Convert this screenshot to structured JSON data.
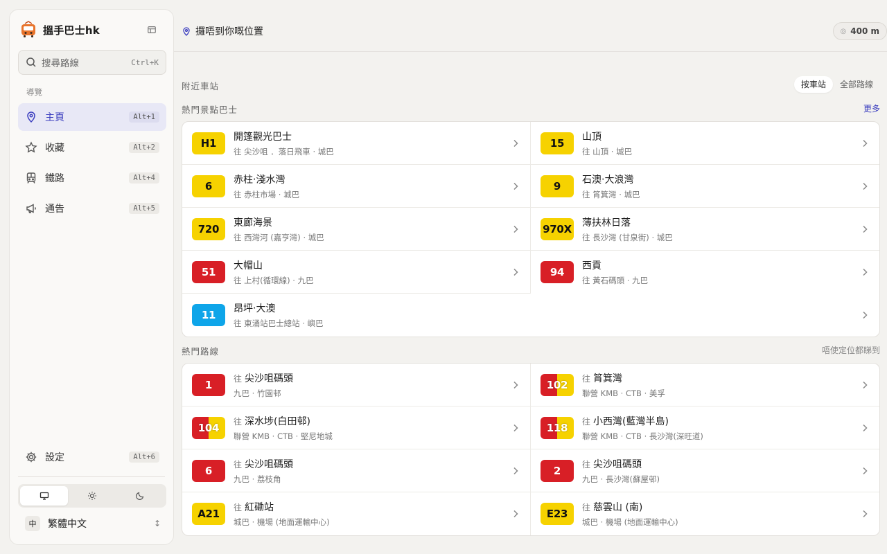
{
  "app": {
    "name": "搵手巴士",
    "name_suffix": "hk"
  },
  "search": {
    "placeholder": "搜尋路線",
    "shortcut": "Ctrl+K"
  },
  "nav": {
    "section_label": "導覽",
    "items": [
      {
        "label": "主頁",
        "shortcut": "Alt+1",
        "icon": "map-pin-icon"
      },
      {
        "label": "收藏",
        "shortcut": "Alt+2",
        "icon": "star-icon"
      },
      {
        "label": "鐵路",
        "shortcut": "Alt+4",
        "icon": "train-icon"
      },
      {
        "label": "通告",
        "shortcut": "Alt+5",
        "icon": "megaphone-icon"
      }
    ],
    "settings": {
      "label": "設定",
      "shortcut": "Alt+6"
    }
  },
  "language": {
    "badge": "中",
    "label": "繁體中文"
  },
  "topbar": {
    "location_text": "攞唔到你嘅位置",
    "radius": "400 m"
  },
  "nearby": {
    "title": "附近車站",
    "toggle": [
      "按車站",
      "全部路線"
    ]
  },
  "scenic": {
    "title": "熱門景點巴士",
    "more": "更多",
    "items": [
      {
        "route": "H1",
        "color": "yellow",
        "name": "開篷觀光巴士",
        "sub": "往 尖沙咀 ．落日飛車 · 城巴"
      },
      {
        "route": "15",
        "color": "yellow",
        "name": "山頂",
        "sub": "往 山頂 · 城巴"
      },
      {
        "route": "6",
        "color": "yellow",
        "name": "赤柱‧淺水灣",
        "sub": "往 赤柱市場 · 城巴"
      },
      {
        "route": "9",
        "color": "yellow",
        "name": "石澳‧大浪灣",
        "sub": "往 筲箕灣 · 城巴"
      },
      {
        "route": "720",
        "color": "yellow",
        "name": "東廊海景",
        "sub": "往 西灣河 (嘉亨灣) · 城巴"
      },
      {
        "route": "970X",
        "color": "yellow",
        "name": "薄扶林日落",
        "sub": "往 長沙灣 (甘泉街) · 城巴"
      },
      {
        "route": "51",
        "color": "red",
        "name": "大帽山",
        "sub": "往 上村(循環線) · 九巴"
      },
      {
        "route": "94",
        "color": "red",
        "name": "西貢",
        "sub": "往 黃石碼頭 · 九巴"
      },
      {
        "route": "11",
        "color": "blue",
        "name": "昂坪‧大澳",
        "sub": "往 東涌站巴士總站 · 嶼巴"
      }
    ]
  },
  "popular": {
    "title": "熱門路線",
    "hint": "唔使定位都睇到",
    "prefix": "往",
    "items": [
      {
        "route": "1",
        "color": "red",
        "dest": "尖沙咀碼頭",
        "sub": "九巴 · 竹園邨"
      },
      {
        "route": "102",
        "color": "split",
        "dest": "筲箕灣",
        "sub": "聯營 KMB · CTB · 美孚"
      },
      {
        "route": "104",
        "color": "split",
        "dest": "深水埗(白田邨)",
        "sub": "聯營 KMB · CTB · 堅尼地城"
      },
      {
        "route": "118",
        "color": "split",
        "dest": "小西灣(藍灣半島)",
        "sub": "聯營 KMB · CTB · 長沙灣(深旺道)"
      },
      {
        "route": "6",
        "color": "red",
        "dest": "尖沙咀碼頭",
        "sub": "九巴 · 荔枝角"
      },
      {
        "route": "2",
        "color": "red",
        "dest": "尖沙咀碼頭",
        "sub": "九巴 · 長沙灣(蘇屋邨)"
      },
      {
        "route": "A21",
        "color": "yellow",
        "dest": "紅磡站",
        "sub": "城巴 · 機場 (地面運輸中心)"
      },
      {
        "route": "E23",
        "color": "yellow",
        "dest": "慈雲山 (南)",
        "sub": "城巴 · 機場 (地面運輸中心)"
      }
    ]
  },
  "colors": {
    "accent": "#3a3dbf",
    "kmb_red": "#d81f26",
    "ctb_yellow": "#f6d200",
    "nlb_blue": "#0ea5e9"
  }
}
